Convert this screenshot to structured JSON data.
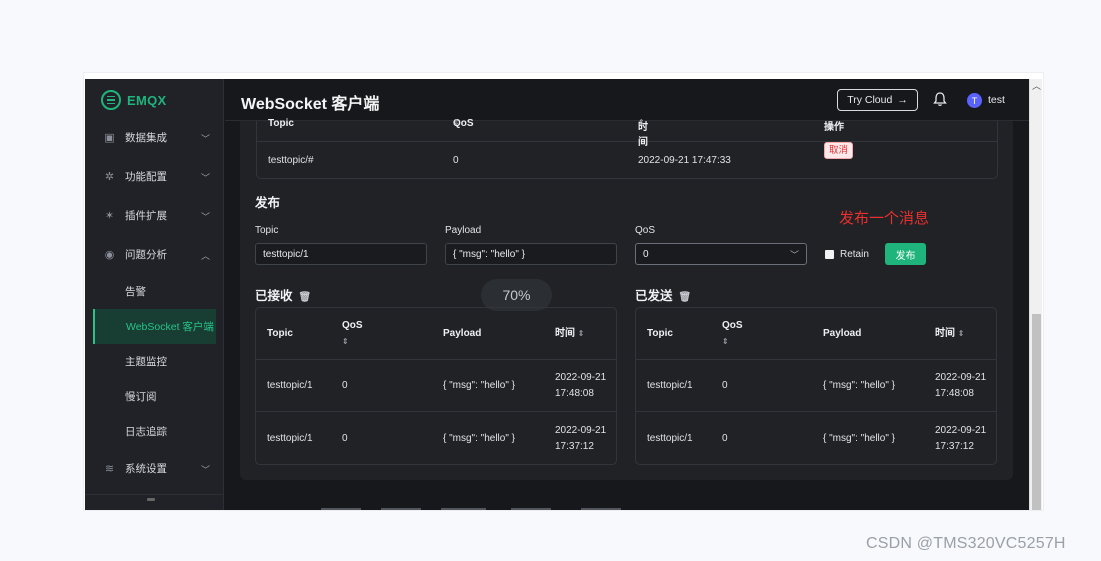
{
  "app": {
    "logo_text": "EMQX",
    "title": "WebSocket 客户端",
    "try_cloud_label": "Try Cloud",
    "avatar_initial": "T",
    "username": "test"
  },
  "sidebar": {
    "items": [
      {
        "label": "数据集成",
        "icon": "data-integration-icon"
      },
      {
        "label": "功能配置",
        "icon": "gear-icon"
      },
      {
        "label": "插件扩展",
        "icon": "plugin-icon"
      },
      {
        "label": "问题分析",
        "icon": "diagnose-icon"
      }
    ],
    "subitems": [
      {
        "label": "告警"
      },
      {
        "label": "WebSocket 客户端",
        "active": true
      },
      {
        "label": "主题监控"
      },
      {
        "label": "慢订阅"
      },
      {
        "label": "日志追踪"
      }
    ],
    "settings": {
      "label": "系统设置",
      "icon": "layers-icon"
    }
  },
  "subscriptions": {
    "columns": [
      "Topic",
      "QoS",
      "时间",
      "操作"
    ],
    "row": {
      "topic": "testtopic/#",
      "qos": "0",
      "time": "2022-09-21 17:47:33",
      "action": "取消"
    }
  },
  "publish": {
    "title": "发布",
    "topic_label": "Topic",
    "topic_value": "testtopic/1",
    "payload_label": "Payload",
    "payload_value": "{ \"msg\": \"hello\" }",
    "qos_label": "QoS",
    "qos_value": "0",
    "retain_label": "Retain",
    "button_label": "发布",
    "annotation": "发布一个消息"
  },
  "zoom": "70%",
  "received": {
    "title": "已接收",
    "columns": [
      "Topic",
      "QoS",
      "Payload",
      "时间"
    ],
    "rows": [
      {
        "topic": "testtopic/1",
        "qos": "0",
        "payload": "{ \"msg\": \"hello\" }",
        "date": "2022-09-21",
        "time": "17:48:08"
      },
      {
        "topic": "testtopic/1",
        "qos": "0",
        "payload": "{ \"msg\": \"hello\" }",
        "date": "2022-09-21",
        "time": "17:37:12"
      }
    ]
  },
  "sent": {
    "title": "已发送",
    "columns": [
      "Topic",
      "QoS",
      "Payload",
      "时间"
    ],
    "rows": [
      {
        "topic": "testtopic/1",
        "qos": "0",
        "payload": "{ \"msg\": \"hello\" }",
        "date": "2022-09-21",
        "time": "17:48:08"
      },
      {
        "topic": "testtopic/1",
        "qos": "0",
        "payload": "{ \"msg\": \"hello\" }",
        "date": "2022-09-21",
        "time": "17:37:12"
      }
    ]
  },
  "watermark": "CSDN @TMS320VC5257H"
}
